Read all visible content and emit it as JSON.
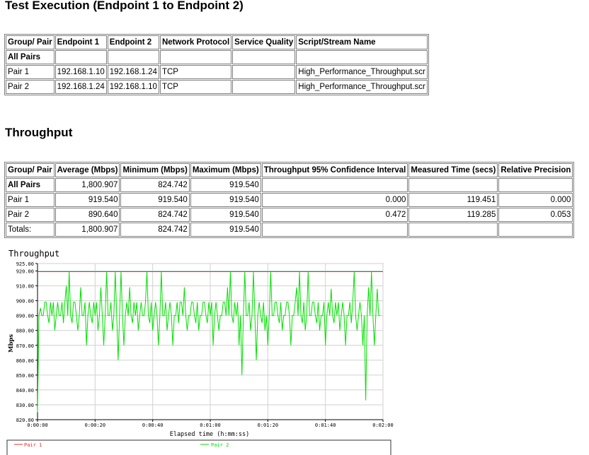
{
  "title": "Test Execution (Endpoint 1 to Endpoint 2)",
  "pairs_table": {
    "headers": [
      "Group/ Pair",
      "Endpoint 1",
      "Endpoint 2",
      "Network Protocol",
      "Service Quality",
      "Script/Stream Name"
    ],
    "rows": [
      [
        "All Pairs",
        "",
        "",
        "",
        "",
        ""
      ],
      [
        "Pair 1",
        "192.168.1.10",
        "192.168.1.24",
        "TCP",
        "",
        "High_Performance_Throughput.scr"
      ],
      [
        "Pair 2",
        "192.168.1.24",
        "192.168.1.10",
        "TCP",
        "",
        "High_Performance_Throughput.scr"
      ]
    ]
  },
  "throughput_heading": "Throughput",
  "throughput_table": {
    "headers": [
      "Group/ Pair",
      "Average (Mbps)",
      "Minimum (Mbps)",
      "Maximum (Mbps)",
      "Throughput 95% Confidence Interval",
      "Measured Time (secs)",
      "Relative Precision"
    ],
    "rows": [
      [
        "All Pairs",
        "1,800.907",
        "824.742",
        "919.540",
        "",
        "",
        ""
      ],
      [
        "Pair 1",
        "919.540",
        "919.540",
        "919.540",
        "0.000",
        "119.451",
        "0.000"
      ],
      [
        "Pair 2",
        "890.640",
        "824.742",
        "919.540",
        "0.472",
        "119.285",
        "0.053"
      ],
      [
        "Totals:",
        "1,800.907",
        "824.742",
        "919.540",
        "",
        "",
        ""
      ]
    ]
  },
  "chart_data": {
    "type": "line",
    "title": "Throughput",
    "xlabel": "Elapsed time (h:mm:ss)",
    "ylabel": "Mbps",
    "xlim": [
      0,
      120
    ],
    "ylim": [
      820,
      925
    ],
    "yticks": [
      "820.00",
      "830.00",
      "840.00",
      "850.00",
      "860.00",
      "870.00",
      "880.00",
      "890.00",
      "900.00",
      "910.00",
      "920.00",
      "925.00"
    ],
    "ytick_values": [
      820,
      830,
      840,
      850,
      860,
      870,
      880,
      890,
      900,
      910,
      920,
      925
    ],
    "xticks": [
      "0:00:00",
      "0:00:20",
      "0:00:40",
      "0:01:00",
      "0:01:20",
      "0:01:40",
      "0:02:00"
    ],
    "xtick_values": [
      0,
      20,
      40,
      60,
      80,
      100,
      120
    ],
    "grid": true,
    "legend_placement": "bottom",
    "series": [
      {
        "name": "Pair 1",
        "color": "#e03030",
        "x": [
          0,
          120
        ],
        "values": [
          919.54,
          919.54
        ]
      },
      {
        "name": "Pair 2",
        "color": "#00e000",
        "x_step": 1,
        "values": [
          825,
          895,
          890,
          899,
          885,
          890,
          880,
          899,
          890,
          885,
          910,
          919.5,
          885,
          899,
          880,
          909,
          890,
          870,
          899,
          885,
          890,
          880,
          909,
          870,
          919.5,
          890,
          880,
          919.5,
          860,
          919.5,
          870,
          899,
          909,
          885,
          890,
          880,
          899,
          890,
          919.5,
          885,
          880,
          899,
          870,
          919.5,
          890,
          880,
          899,
          870,
          890,
          885,
          899,
          909,
          880,
          890,
          899,
          885,
          880,
          890,
          899,
          885,
          890,
          870,
          899,
          880,
          890,
          899,
          909,
          919.5,
          885,
          890,
          870,
          850,
          919.5,
          890,
          880,
          919.5,
          860,
          899,
          885,
          880,
          870,
          919.5,
          890,
          899,
          885,
          880,
          890,
          899,
          870,
          890,
          909,
          919.5,
          885,
          880,
          919.5,
          890,
          899,
          885,
          880,
          890,
          870,
          899,
          908,
          885,
          890,
          880,
          899,
          870,
          890,
          885,
          919.5,
          880,
          899,
          870,
          833,
          909,
          919.5,
          870,
          908,
          890
        ]
      }
    ]
  }
}
